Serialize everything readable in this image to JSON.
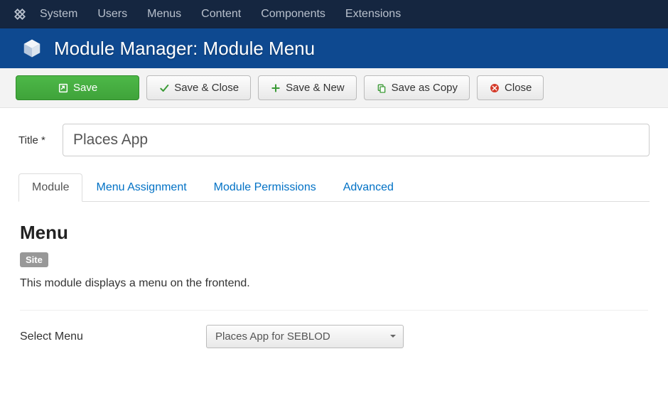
{
  "topbar": {
    "items": [
      "System",
      "Users",
      "Menus",
      "Content",
      "Components",
      "Extensions"
    ]
  },
  "header": {
    "title": "Module Manager: Module Menu"
  },
  "toolbar": {
    "save": "Save",
    "save_close": "Save & Close",
    "save_new": "Save & New",
    "save_copy": "Save as Copy",
    "close": "Close"
  },
  "title_field": {
    "label": "Title *",
    "value": "Places App"
  },
  "tabs": {
    "items": [
      {
        "label": "Module",
        "active": true
      },
      {
        "label": "Menu Assignment",
        "active": false
      },
      {
        "label": "Module Permissions",
        "active": false
      },
      {
        "label": "Advanced",
        "active": false
      }
    ]
  },
  "panel": {
    "heading": "Menu",
    "badge": "Site",
    "description": "This module displays a menu on the frontend.",
    "select_menu_label": "Select Menu",
    "select_menu_value": "Places App for SEBLOD"
  }
}
